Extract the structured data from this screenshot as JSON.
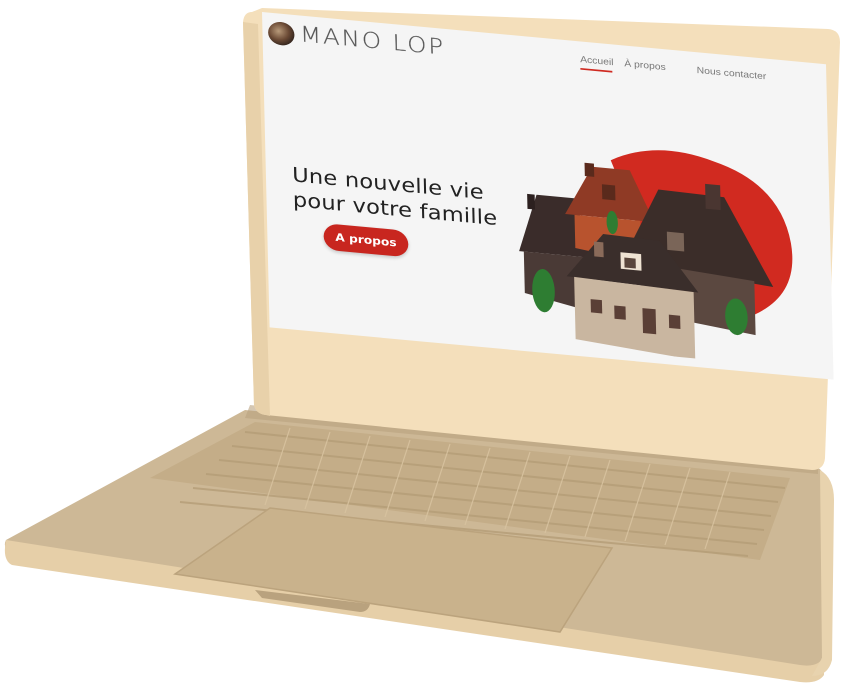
{
  "header": {
    "logo_text": "MANO LOP",
    "nav": [
      "Accueil",
      "À propos",
      "Nous contacter"
    ]
  },
  "hero": {
    "title_line1": "Une nouvelle vie",
    "title_line2": "pour votre famille",
    "cta_label": "A propos"
  },
  "colors": {
    "accent": "#c8261f",
    "laptop_body": "#cdb896",
    "laptop_rim": "#f4dfbb",
    "screen_bg": "#f5f5f5"
  },
  "icons": {
    "logo": "avatar-logo-icon",
    "illustration": "houses-illustration"
  }
}
